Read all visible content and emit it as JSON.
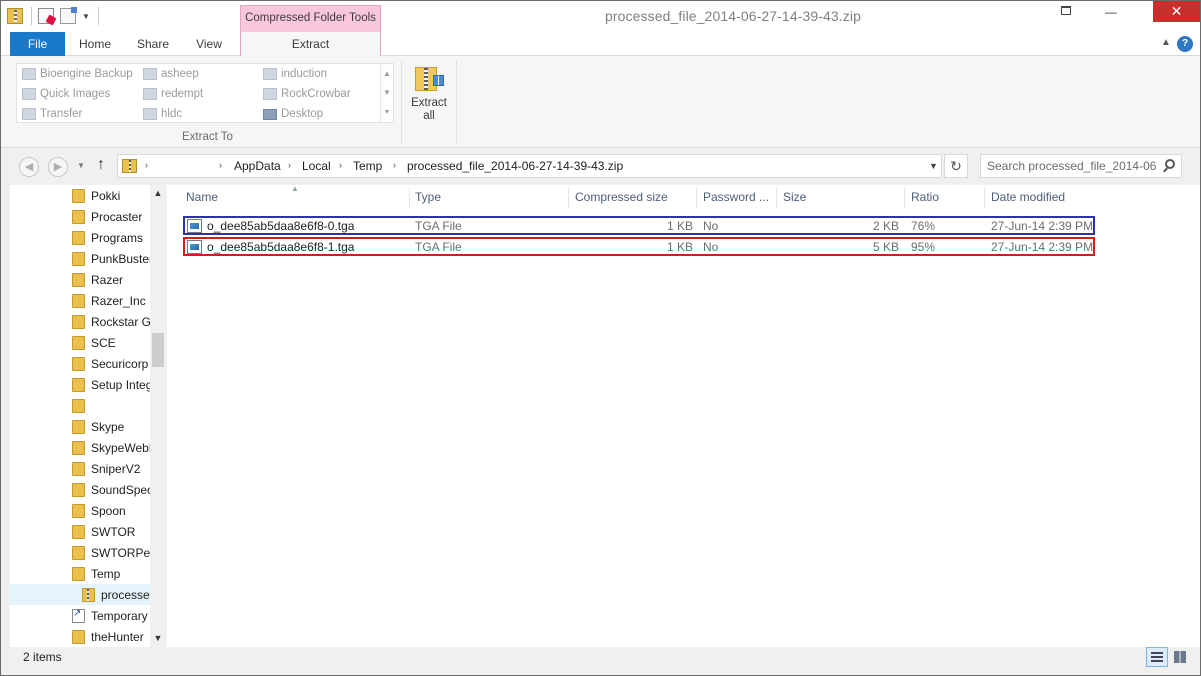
{
  "window": {
    "title": "processed_file_2014-06-27-14-39-43.zip",
    "minimize_glyph": "—",
    "close_glyph": "✕"
  },
  "ribbon": {
    "context_tab": "Compressed Folder Tools",
    "tabs": {
      "file": "File",
      "home": "Home",
      "share": "Share",
      "view": "View",
      "extract": "Extract"
    },
    "extract_to": {
      "items": [
        {
          "label": "Bioengine Backup",
          "icon": "folder-icon"
        },
        {
          "label": "Quick Images",
          "icon": "folder-icon"
        },
        {
          "label": "Transfer",
          "icon": "folder-icon"
        },
        {
          "label": "asheep",
          "icon": "folder-icon"
        },
        {
          "label": "redempt",
          "icon": "folder-icon"
        },
        {
          "label": "hldc",
          "icon": "folder-icon"
        },
        {
          "label": "induction",
          "icon": "folder-icon"
        },
        {
          "label": "RockCrowbar",
          "icon": "folder-icon"
        },
        {
          "label": "Desktop",
          "icon": "desktop-icon"
        }
      ],
      "group_label": "Extract To"
    },
    "extract_all": {
      "line1": "Extract",
      "line2": "all"
    }
  },
  "address": {
    "crumbs": [
      "AppData",
      "Local",
      "Temp",
      "processed_file_2014-06-27-14-39-43.zip"
    ],
    "search_placeholder": "Search processed_file_2014-06..."
  },
  "nav_pane": {
    "items": [
      {
        "label": "Pokki",
        "kind": "folder"
      },
      {
        "label": "Procaster",
        "kind": "folder"
      },
      {
        "label": "Programs",
        "kind": "folder"
      },
      {
        "label": "PunkBuster",
        "kind": "folder"
      },
      {
        "label": "Razer",
        "kind": "folder"
      },
      {
        "label": "Razer_Inc",
        "kind": "folder"
      },
      {
        "label": "Rockstar Ga",
        "kind": "folder"
      },
      {
        "label": "SCE",
        "kind": "folder"
      },
      {
        "label": "Securicorp",
        "kind": "folder"
      },
      {
        "label": "Setup Integ",
        "kind": "folder"
      },
      {
        "label": "",
        "kind": "folder"
      },
      {
        "label": "Skype",
        "kind": "folder"
      },
      {
        "label": "SkypeWebP",
        "kind": "folder"
      },
      {
        "label": "SniperV2",
        "kind": "folder"
      },
      {
        "label": "SoundSpec",
        "kind": "folder"
      },
      {
        "label": "Spoon",
        "kind": "folder"
      },
      {
        "label": "SWTOR",
        "kind": "folder"
      },
      {
        "label": "SWTORPer",
        "kind": "folder"
      },
      {
        "label": "Temp",
        "kind": "folder"
      },
      {
        "label": "processe",
        "kind": "zip",
        "selected": true
      },
      {
        "label": "Temporary",
        "kind": "shortcut"
      },
      {
        "label": "theHunter",
        "kind": "folder"
      }
    ]
  },
  "file_list": {
    "columns": {
      "name": "Name",
      "type": "Type",
      "compressed_size": "Compressed size",
      "password": "Password ...",
      "size": "Size",
      "ratio": "Ratio",
      "date_modified": "Date modified"
    },
    "rows": [
      {
        "name": "o_dee85ab5daa8e6f8-0.tga",
        "type": "TGA File",
        "compressed_size": "1 KB",
        "password": "No",
        "size": "2 KB",
        "ratio": "76%",
        "date_modified": "27-Jun-14 2:39 PM",
        "highlight": "#2a33a8"
      },
      {
        "name": "o_dee85ab5daa8e6f8-1.tga",
        "type": "TGA File",
        "compressed_size": "1 KB",
        "password": "No",
        "size": "5 KB",
        "ratio": "95%",
        "date_modified": "27-Jun-14 2:39 PM",
        "highlight": "#d21d1d"
      }
    ]
  },
  "status": {
    "items_count": "2 items"
  },
  "colors": {
    "file_tab": "#1979ca",
    "context_tab": "#f8c7dc",
    "close_button": "#c7302b"
  }
}
